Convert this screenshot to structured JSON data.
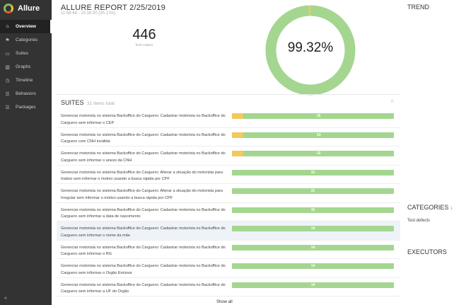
{
  "app": {
    "brand": "Allure"
  },
  "sidebar": {
    "items": [
      {
        "label": "Overview",
        "icon": "home-icon",
        "glyph": "⌂"
      },
      {
        "label": "Categories",
        "icon": "flag-icon",
        "glyph": "⚑"
      },
      {
        "label": "Suites",
        "icon": "briefcase-icon",
        "glyph": "▭"
      },
      {
        "label": "Graphs",
        "icon": "bar-chart-icon",
        "glyph": "▥"
      },
      {
        "label": "Timeline",
        "icon": "clock-icon",
        "glyph": "◷"
      },
      {
        "label": "Behaviors",
        "icon": "list-icon",
        "glyph": "☰"
      },
      {
        "label": "Packages",
        "icon": "align-left-icon",
        "glyph": "☰"
      }
    ],
    "collapse_glyph": "«"
  },
  "report": {
    "title": "ALLURE REPORT 2/25/2019",
    "time": "11:58:44 - 15:16:00 (3h 17m)",
    "count": "446",
    "count_label": "test cases",
    "percent": "99.32%",
    "pass_fraction": 0.9932,
    "colors": {
      "passed": "#a4d690",
      "broken": "#f3c85c"
    }
  },
  "suites": {
    "title": "SUITES",
    "subtitle": "31 items total",
    "tool": "⇵",
    "rows": [
      {
        "text": "Gerenciar motorista no sistema Backoffice do Carguero: Cadastrar motorista no Backoffice do Carguero sem informar o CEP",
        "broken": 0.07,
        "label": "16"
      },
      {
        "text": "Gerenciar motorista no sistema Backoffice do Carguero: Cadastrar motorista no Backoffice do Carguero com CNH inválida",
        "broken": 0.07,
        "label": "14"
      },
      {
        "text": "Gerenciar motorista no sistema Backoffice do Carguero: Cadastrar motorista no Backoffice do Carguero sem informar o anexo da CNH",
        "broken": 0.07,
        "label": "15"
      },
      {
        "text": "Gerenciar motorista no sistema Backoffice do Carguero: Alterar a situação do motorista para Inativo sem informar o motivo usando a busca rápida por CPF",
        "broken": 0,
        "label": "31"
      },
      {
        "text": "Gerenciar motorista no sistema Backoffice do Carguero: Alterar a situação do motorista para Irregular sem informar o motivo usando a busca rápida por CPF",
        "broken": 0,
        "label": "31"
      },
      {
        "text": "Gerenciar motorista no sistema Backoffice do Carguero: Cadastrar motorista no Backoffice do Carguero sem informar a data de nascimento",
        "broken": 0,
        "label": "16"
      },
      {
        "text": "Gerenciar motorista no sistema Backoffice do Carguero: Cadastrar motorista no Backoffice do Carguero sem informar o nome da mãe",
        "broken": 0,
        "label": "14",
        "selected": true
      },
      {
        "text": "Gerenciar motorista no sistema Backoffice do Carguero: Cadastrar motorista no Backoffice do Carguero sem informar o RG",
        "broken": 0,
        "label": "14"
      },
      {
        "text": "Gerenciar motorista no sistema Backoffice do Carguero: Cadastrar motorista no Backoffice do Carguero sem informar o Orgão Emissor",
        "broken": 0,
        "label": "14"
      },
      {
        "text": "Gerenciar motorista no sistema Backoffice do Carguero: Cadastrar motorista no Backoffice do Carguero sem informar a UF do Orgão",
        "broken": 0,
        "label": "14"
      }
    ],
    "show_all": "Show all"
  },
  "trend": {
    "title": "TREND"
  },
  "categories": {
    "title": "CATEGORIES",
    "count": "1 c",
    "items": [
      "Test defects"
    ]
  },
  "executors": {
    "title": "EXECUTORS"
  }
}
